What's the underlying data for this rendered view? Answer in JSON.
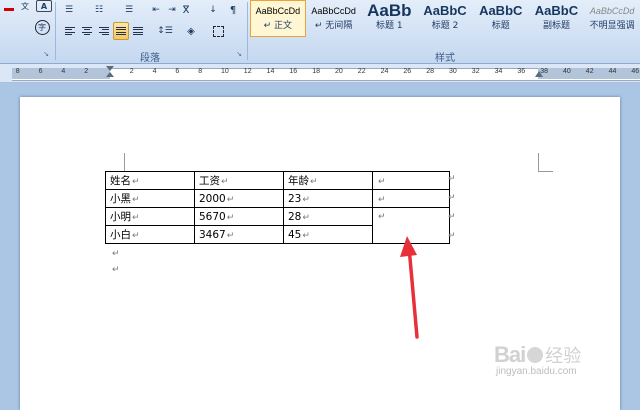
{
  "ribbon": {
    "group_paragraph": "段落",
    "group_styles": "样式",
    "styles": [
      {
        "preview": "AaBbCcDd",
        "name": "↵ 正文",
        "selected": true
      },
      {
        "preview": "AaBbCcDd",
        "name": "↵ 无间隔",
        "selected": false
      },
      {
        "preview": "AaBb",
        "name": "标题 1",
        "selected": false
      },
      {
        "preview": "AaBbC",
        "name": "标题 2",
        "selected": false
      },
      {
        "preview": "AaBbC",
        "name": "标题",
        "selected": false
      },
      {
        "preview": "AaBbC",
        "name": "副标题",
        "selected": false
      },
      {
        "preview": "AaBbCcDd",
        "name": "不明显强调",
        "selected": false
      }
    ]
  },
  "ruler": {
    "numbers": [
      "8",
      "6",
      "4",
      "2",
      "2",
      "4",
      "6",
      "8",
      "10",
      "12",
      "14",
      "16",
      "18",
      "20",
      "22",
      "24",
      "26",
      "28",
      "30",
      "32",
      "34",
      "36",
      "38",
      "40",
      "42",
      "44",
      "46",
      "48"
    ]
  },
  "table": {
    "rows": [
      [
        "姓名",
        "工资",
        "年龄",
        ""
      ],
      [
        "小黑",
        "2000",
        "23",
        ""
      ],
      [
        "小明",
        "5670",
        "28",
        ""
      ],
      [
        "小白",
        "3467",
        "45",
        null
      ]
    ]
  },
  "marks": {
    "para": "↵"
  },
  "watermark": {
    "brand": "Bai",
    "brand2": "经验",
    "url": "jingyan.baidu.com"
  },
  "colors": {
    "arrow": "#e8303a",
    "selected_style_border": "#e8a33c"
  }
}
